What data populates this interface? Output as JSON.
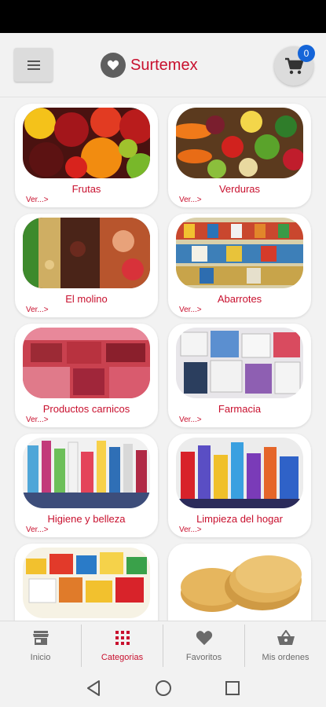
{
  "app": {
    "title": "Surtemex",
    "cart_count": "0",
    "brand_color": "#c8102e",
    "badge_color": "#1565d8"
  },
  "categories": [
    {
      "label": "Frutas",
      "more": "Ver...>",
      "image": "fruits-photo"
    },
    {
      "label": "Verduras",
      "more": "Ver...>",
      "image": "vegetables-photo"
    },
    {
      "label": "El molino",
      "more": "Ver...>",
      "image": "mill-photo"
    },
    {
      "label": "Abarrotes",
      "more": "Ver...>",
      "image": "groceries-photo"
    },
    {
      "label": "Productos carnicos",
      "more": "Ver...>",
      "image": "meat-photo"
    },
    {
      "label": "Farmacia",
      "more": "Ver...>",
      "image": "pharmacy-photo"
    },
    {
      "label": "Higiene y belleza",
      "more": "Ver...>",
      "image": "hygiene-photo"
    },
    {
      "label": "Limpieza del hogar",
      "more": "Ver...>",
      "image": "cleaning-photo"
    },
    {
      "label": "",
      "more": "",
      "image": "wholesale-photo"
    },
    {
      "label": "",
      "more": "",
      "image": "tortillas-photo"
    }
  ],
  "bottom_nav": [
    {
      "label": "Inicio",
      "icon": "store-icon"
    },
    {
      "label": "Categorias",
      "icon": "grid-icon",
      "active": true
    },
    {
      "label": "Favoritos",
      "icon": "heart-icon"
    },
    {
      "label": "Mis ordenes",
      "icon": "basket-icon"
    }
  ],
  "system_nav": [
    "back-icon",
    "home-icon",
    "recents-icon"
  ]
}
